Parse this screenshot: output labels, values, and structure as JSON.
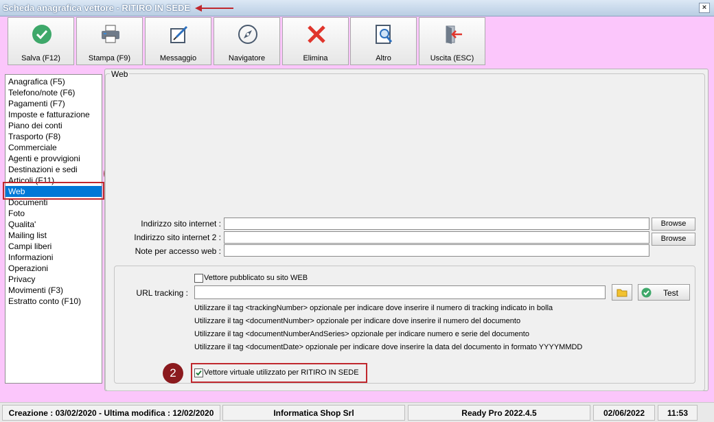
{
  "window": {
    "title": "Scheda anagrafica vettore - RITIRO IN SEDE",
    "close_label": "×"
  },
  "toolbar": {
    "buttons": [
      {
        "label": "Salva (F12)",
        "icon": "check-circle-icon"
      },
      {
        "label": "Stampa (F9)",
        "icon": "printer-icon"
      },
      {
        "label": "Messaggio",
        "icon": "compose-message-icon"
      },
      {
        "label": "Navigatore",
        "icon": "compass-icon"
      },
      {
        "label": "Elimina",
        "icon": "red-x-icon"
      },
      {
        "label": "Altro",
        "icon": "magnifier-document-icon"
      },
      {
        "label": "Uscita (ESC)",
        "icon": "exit-door-icon"
      }
    ]
  },
  "nav": {
    "items": [
      "Anagrafica (F5)",
      "Telefono/note (F6)",
      "Pagamenti (F7)",
      "Imposte e fatturazione",
      "Piano dei conti",
      "Trasporto (F8)",
      "Commerciale",
      "Agenti e provvigioni",
      "Destinazioni e sedi",
      "Articoli (F11)",
      "Web",
      "Documenti",
      "Foto",
      "Qualita'",
      "Mailing list",
      "Campi liberi",
      "Informazioni",
      "Operazioni",
      "Privacy",
      "Movimenti (F3)",
      "Estratto conto (F10)"
    ],
    "selected": "Web"
  },
  "annotations": {
    "badge1": "1",
    "badge2": "2",
    "accent": "#c0272d",
    "badge_color": "#8b1a1e"
  },
  "web": {
    "group_title": "Web",
    "site_label": "Indirizzo sito internet :",
    "site_value": "",
    "site2_label": "Indirizzo sito internet 2 :",
    "site2_value": "",
    "notes_label": "Note per accesso web :",
    "notes_value": "",
    "browse_label": "Browse",
    "published_label": "Vettore pubblicato su sito WEB",
    "published_checked": false,
    "url_tracking_label": "URL tracking :",
    "url_tracking_value": "",
    "test_label": "Test",
    "notes": [
      "Utilizzare il tag <trackingNumber> opzionale per indicare dove inserire il numero di tracking indicato in bolla",
      "Utilizzare il tag <documentNumber> opzionale per indicare dove inserire il numero del documento",
      "Utilizzare il tag <documentNumberAndSeries> opzionale per indicare numero e serie del documento",
      "Utilizzare il tag <documentDate> opzionale per indicare dove inserire la data del documento in formato YYYYMMDD"
    ],
    "virtual_label": "Vettore virtuale utilizzato per RITIRO IN SEDE",
    "virtual_checked": true
  },
  "status": {
    "created": "Creazione : 03/02/2020 - Ultima modifica : 12/02/2020",
    "company": "Informatica Shop Srl",
    "version": "Ready Pro 2022.4.5",
    "date": "02/06/2022",
    "time": "11:53"
  }
}
